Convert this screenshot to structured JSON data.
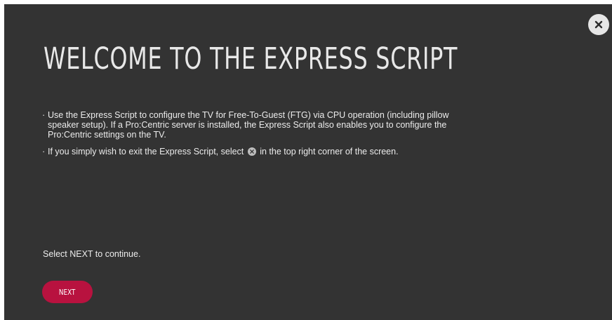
{
  "screen": {
    "title": "WELCOME TO THE EXPRESS SCRIPT",
    "bullet_marker": "·",
    "bullets": [
      "Use the Express Script to configure the TV for Free-To-Guest (FTG) via CPU operation (including pillow speaker setup). If a Pro:Centric server is installed, the Express Script also enables you to configure the Pro:Centric settings on the TV.",
      {
        "before_icon": "If you simply wish to exit the Express Script, select ",
        "after_icon": " in the top right corner of the screen."
      }
    ],
    "continue_text": "Select NEXT to continue.",
    "next_label": "NEXT",
    "close_icon": "close-icon"
  },
  "colors": {
    "background": "#333333",
    "text": "#ececec",
    "accent": "#b8123f",
    "close_button": "#e6e6e6"
  }
}
